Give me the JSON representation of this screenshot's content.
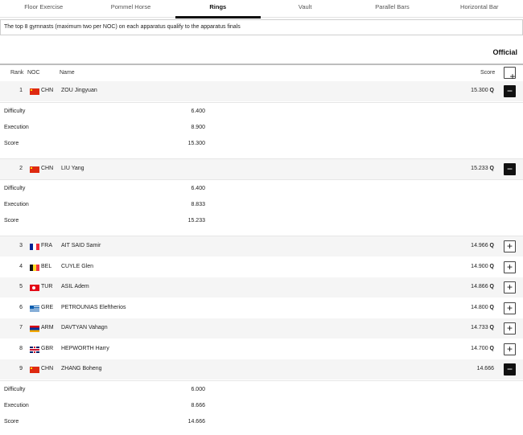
{
  "tabs": [
    "Floor Exercise",
    "Pommel Horse",
    "Rings",
    "Vault",
    "Parallel Bars",
    "Horizontal Bar"
  ],
  "active_tab": "Rings",
  "notice": "The top 8 gymnasts (maximum two per NOC) on each apparatus qualify to the apparatus finals",
  "status": "Official",
  "headers": {
    "rank": "Rank",
    "noc": "NOC",
    "name": "Name",
    "score": "Score"
  },
  "detail_labels": {
    "difficulty": "Difficulty",
    "execution": "Execution",
    "score": "Score"
  },
  "results": [
    {
      "rank": "1",
      "noc": "CHN",
      "flag": "flag-chn",
      "name": "ZOU Jingyuan",
      "score": "15.300",
      "q": "Q",
      "expanded": true,
      "difficulty": "6.400",
      "execution": "8.900",
      "total": "15.300"
    },
    {
      "rank": "2",
      "noc": "CHN",
      "flag": "flag-chn",
      "name": "LIU Yang",
      "score": "15.233",
      "q": "Q",
      "expanded": true,
      "difficulty": "6.400",
      "execution": "8.833",
      "total": "15.233"
    },
    {
      "rank": "3",
      "noc": "FRA",
      "flag": "flag-fra",
      "name": "AIT SAID Samir",
      "score": "14.966",
      "q": "Q",
      "expanded": false
    },
    {
      "rank": "4",
      "noc": "BEL",
      "flag": "flag-bel",
      "name": "CUYLE Glen",
      "score": "14.900",
      "q": "Q",
      "expanded": false
    },
    {
      "rank": "5",
      "noc": "TUR",
      "flag": "flag-tur",
      "name": "ASIL Adem",
      "score": "14.866",
      "q": "Q",
      "expanded": false
    },
    {
      "rank": "6",
      "noc": "GRE",
      "flag": "flag-gre",
      "name": "PETROUNIAS Eleftherios",
      "score": "14.800",
      "q": "Q",
      "expanded": false
    },
    {
      "rank": "7",
      "noc": "ARM",
      "flag": "flag-arm",
      "name": "DAVTYAN Vahagn",
      "score": "14.733",
      "q": "Q",
      "expanded": false
    },
    {
      "rank": "8",
      "noc": "GBR",
      "flag": "flag-gbr",
      "name": "HEPWORTH Harry",
      "score": "14.700",
      "q": "Q",
      "expanded": false
    },
    {
      "rank": "9",
      "noc": "CHN",
      "flag": "flag-chn",
      "name": "ZHANG Boheng",
      "score": "14.666",
      "q": "",
      "expanded": true,
      "difficulty": "6.000",
      "execution": "8.666",
      "total": "14.666"
    }
  ],
  "icons": {
    "expand": "plus-icon",
    "collapse": "minus-icon"
  }
}
